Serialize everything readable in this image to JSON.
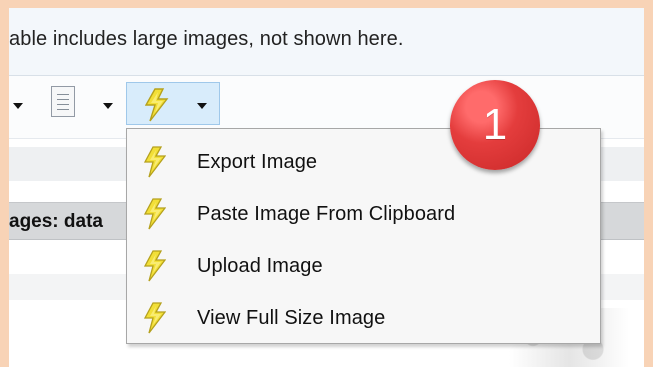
{
  "notice": {
    "text": "able includes large images, not shown here."
  },
  "toolbar": {
    "image_tools_icon": "lightning-bolt-icon"
  },
  "context_menu": {
    "items": [
      {
        "label": "Export Image",
        "icon": "lightning-bolt-icon"
      },
      {
        "label": "Paste Image From Clipboard",
        "icon": "lightning-bolt-icon"
      },
      {
        "label": "Upload Image",
        "icon": "lightning-bolt-icon"
      },
      {
        "label": "View Full Size Image",
        "icon": "lightning-bolt-icon"
      }
    ]
  },
  "section": {
    "label": "ages: data"
  },
  "annotation": {
    "step_number": "1",
    "color": "#e43d3d"
  },
  "colors": {
    "border_frame": "#f8d3b6",
    "selection_blue": "#d8ecfb",
    "bolt_yellow": "#f2df37"
  }
}
